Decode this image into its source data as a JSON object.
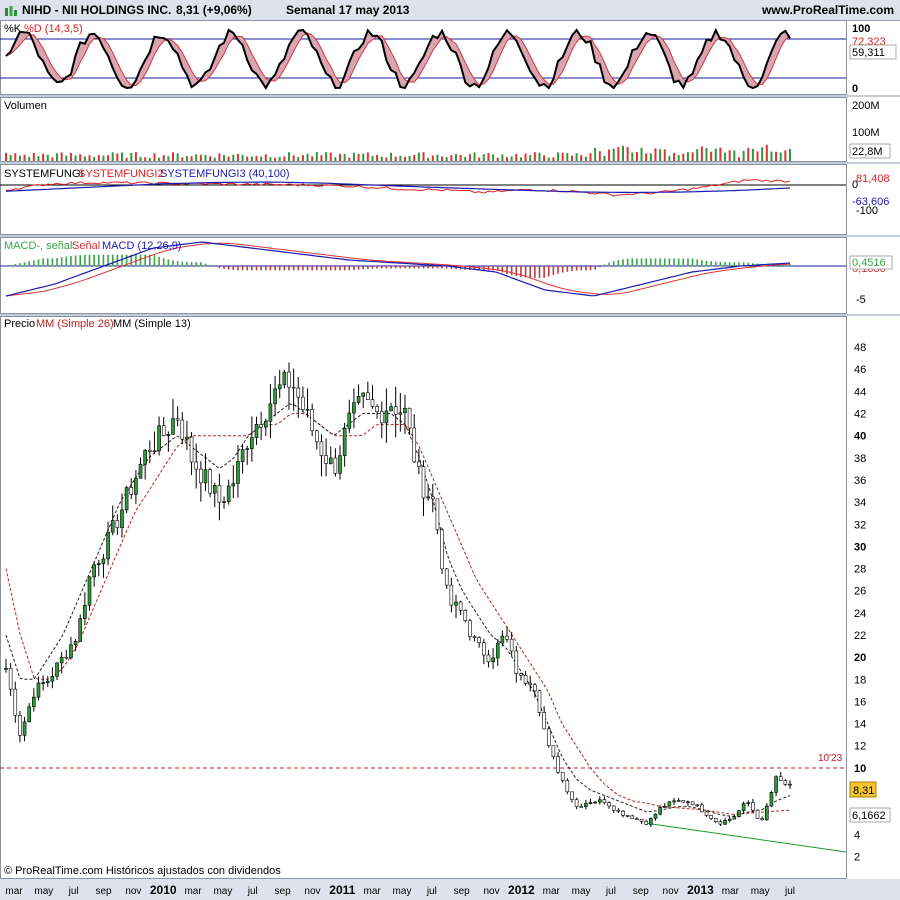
{
  "header": {
    "title": "NIHD - NII HOLDINGS INC.",
    "price_change": "8,31 (+9,06%)",
    "period_date": "Semanal  17 may 2013",
    "site": "www.ProRealTime.com"
  },
  "panels": {
    "stoch": {
      "label_k": "%K",
      "label_d": "%D (14,3,5)",
      "value_k": "72,323",
      "value_d": "59,311",
      "ticks": [
        "100",
        "0"
      ]
    },
    "volume": {
      "label": "Volumen",
      "value": "22,8M",
      "ticks": [
        "200M",
        "100M"
      ]
    },
    "sysfungi": {
      "label1": "SYSTEMFUNGI",
      "label2": "SYSTEMFUNGI2",
      "label3": "SYSTEMFUNGI3 (40,100)",
      "value_red": "81,408",
      "value_blue": "-63,606",
      "ticks": [
        "0",
        "-100"
      ]
    },
    "macd": {
      "label1": "MACD-, señal",
      "label2": "Señal",
      "label3": "MACD (12,26,9)",
      "value_main": "0,4516",
      "value_second": "0,1636",
      "ticks": [
        "-5"
      ]
    },
    "price": {
      "label1": "Precio",
      "label2": "MM (Simple 26)",
      "label3": "MM (Simple 13)",
      "last_price": "8,31",
      "ma_value": "6,1662",
      "resistance_label": "10'23"
    }
  },
  "footer_note": "© ProRealTime.com Históricos ajustados con dividendos",
  "x_axis": [
    {
      "label": "mar",
      "bold": false
    },
    {
      "label": "may",
      "bold": false
    },
    {
      "label": "jul",
      "bold": false
    },
    {
      "label": "sep",
      "bold": false
    },
    {
      "label": "nov",
      "bold": false
    },
    {
      "label": "2010",
      "bold": true
    },
    {
      "label": "mar",
      "bold": false
    },
    {
      "label": "may",
      "bold": false
    },
    {
      "label": "jul",
      "bold": false
    },
    {
      "label": "sep",
      "bold": false
    },
    {
      "label": "nov",
      "bold": false
    },
    {
      "label": "2011",
      "bold": true
    },
    {
      "label": "mar",
      "bold": false
    },
    {
      "label": "may",
      "bold": false
    },
    {
      "label": "jul",
      "bold": false
    },
    {
      "label": "sep",
      "bold": false
    },
    {
      "label": "nov",
      "bold": false
    },
    {
      "label": "2012",
      "bold": true
    },
    {
      "label": "mar",
      "bold": false
    },
    {
      "label": "may",
      "bold": false
    },
    {
      "label": "jul",
      "bold": false
    },
    {
      "label": "sep",
      "bold": false
    },
    {
      "label": "nov",
      "bold": false
    },
    {
      "label": "2013",
      "bold": true
    },
    {
      "label": "mar",
      "bold": false
    },
    {
      "label": "may",
      "bold": false
    },
    {
      "label": "jul",
      "bold": false
    }
  ],
  "chart_data": {
    "type": "line",
    "title": "NIHD - NII HOLDINGS INC.",
    "frequency": "weekly",
    "y_ticks": [
      2,
      4,
      6,
      8,
      10,
      12,
      14,
      16,
      18,
      20,
      22,
      24,
      26,
      28,
      30,
      32,
      34,
      36,
      38,
      40,
      42,
      44,
      46,
      48
    ],
    "ylim": [
      1.5,
      49
    ],
    "resistance_level": 10.23,
    "last_close": 8.31,
    "ma26_last": 6.1662,
    "series": [
      {
        "name": "Precio",
        "x_month_index": [
          0,
          1,
          2,
          3,
          4,
          5,
          6,
          7,
          8,
          9,
          10,
          11,
          12,
          13,
          14,
          15,
          16,
          17,
          18,
          19,
          20,
          21,
          22,
          23,
          24,
          25,
          26,
          27,
          28,
          29,
          30,
          31,
          32,
          33,
          34,
          35,
          36,
          37,
          38,
          39,
          40,
          41,
          42,
          43,
          44,
          45,
          46,
          47,
          48,
          49,
          50,
          51,
          52,
          53,
          54,
          55,
          56,
          57,
          58,
          59,
          60,
          61,
          62,
          63,
          64,
          65,
          66,
          67,
          68,
          69,
          70,
          71,
          72,
          73,
          74,
          75,
          76,
          77,
          78,
          79,
          80,
          81,
          82
        ],
        "values": [
          19,
          13,
          17,
          18,
          20,
          22,
          28,
          30,
          33,
          36,
          39,
          40,
          42,
          38,
          36,
          34,
          36,
          40,
          42,
          44,
          45,
          42,
          39,
          37,
          41,
          43,
          42,
          43,
          42,
          36,
          34,
          25,
          24,
          21,
          20,
          22,
          18,
          18,
          12,
          9,
          6.5,
          7,
          7,
          6,
          5.5,
          5,
          6.5,
          7,
          7,
          6,
          5,
          5.5,
          7,
          5,
          9,
          8.3
        ]
      },
      {
        "name": "MM (Simple 26)",
        "values": [
          28,
          22,
          18,
          18,
          19,
          21,
          24,
          27,
          30,
          33,
          35,
          37,
          39,
          40,
          40,
          40,
          40,
          40,
          41,
          41,
          42,
          42,
          41,
          40,
          40,
          40,
          41,
          41,
          41,
          39,
          36,
          33,
          30,
          27,
          25,
          23,
          21,
          19,
          17,
          14,
          12,
          10,
          8.5,
          7.5,
          7,
          6.8,
          6.5,
          6.4,
          6.3,
          6.2,
          6,
          5.8,
          5.9,
          6,
          6.1,
          6.17
        ]
      },
      {
        "name": "MM (Simple 13)",
        "values": [
          22,
          18,
          18,
          20,
          22,
          25,
          28,
          31,
          34,
          36,
          38,
          39,
          40,
          39,
          38,
          37,
          38,
          40,
          41,
          42,
          43,
          42,
          41,
          40,
          41,
          42,
          42,
          42,
          41,
          38,
          34,
          29,
          26,
          24,
          22,
          21,
          19,
          17,
          14,
          11,
          9,
          8,
          7.5,
          7,
          6.5,
          6,
          6.2,
          6.5,
          6.5,
          6.2,
          5.8,
          5.6,
          6,
          6.2,
          7,
          7.5
        ]
      }
    ]
  }
}
